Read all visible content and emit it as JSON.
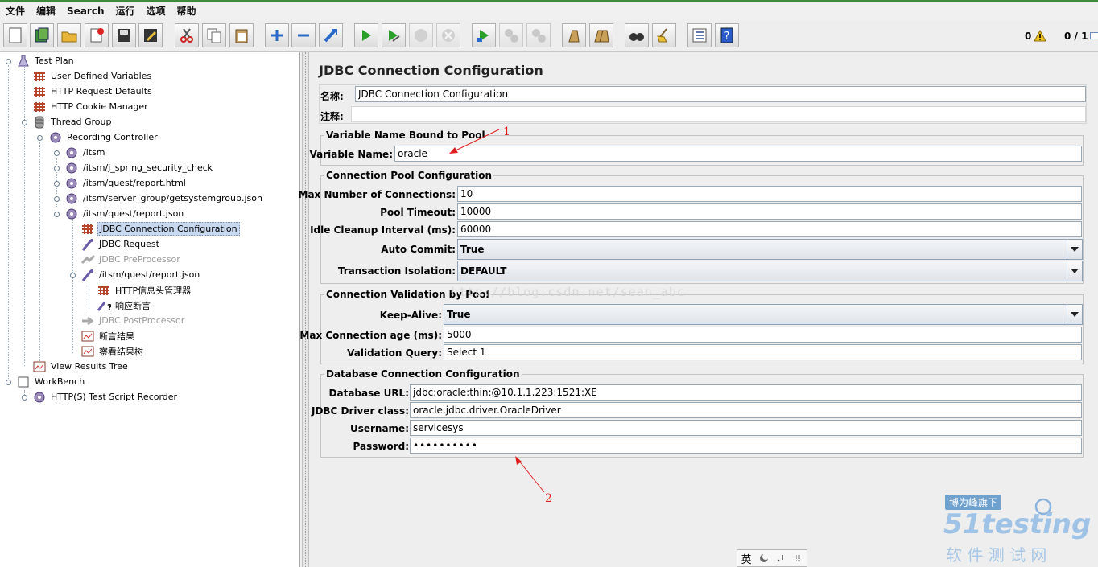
{
  "menu": [
    "文件",
    "编辑",
    "Search",
    "运行",
    "选项",
    "帮助"
  ],
  "toolbar": {
    "buttons": [
      "new-icon",
      "templates-icon",
      "open-icon",
      "close-file-icon",
      "save-icon",
      "save-as-icon",
      "cut-icon",
      "copy-icon",
      "paste-icon",
      "expand-icon",
      "collapse-icon",
      "toggle-icon",
      "start-icon",
      "start-no-pause-icon",
      "stop-icon",
      "shutdown-icon",
      "remote-start-icon",
      "remote-stop-icon",
      "remote-exit-icon",
      "clear-icon",
      "clear-all-icon",
      "search-icon",
      "reset-search-icon",
      "function-helper-icon",
      "help-icon"
    ],
    "error_count": "0",
    "threads": "0 / 1"
  },
  "tree": [
    {
      "label": "Test Plan",
      "icon": "test-plan-icon"
    },
    {
      "label": "User Defined Variables",
      "icon": "config-element-icon"
    },
    {
      "label": "HTTP Request Defaults",
      "icon": "config-element-icon"
    },
    {
      "label": "HTTP Cookie Manager",
      "icon": "config-element-icon"
    },
    {
      "label": "Thread Group",
      "icon": "thread-group-icon"
    },
    {
      "label": "Recording Controller",
      "icon": "controller-icon"
    },
    {
      "label": "/itsm",
      "icon": "controller-icon"
    },
    {
      "label": "/itsm/j_spring_security_check",
      "icon": "controller-icon"
    },
    {
      "label": "/itsm/quest/report.html",
      "icon": "controller-icon"
    },
    {
      "label": "/itsm/server_group/getsystemgroup.json",
      "icon": "controller-icon"
    },
    {
      "label": "/itsm/quest/report.json",
      "icon": "controller-icon"
    },
    {
      "label": "JDBC Connection Configuration",
      "icon": "config-element-icon",
      "selected": true
    },
    {
      "label": "JDBC Request",
      "icon": "sampler-icon"
    },
    {
      "label": "JDBC PreProcessor",
      "icon": "preprocessor-icon",
      "disabled": true
    },
    {
      "label": "/itsm/quest/report.json",
      "icon": "sampler-icon"
    },
    {
      "label": "HTTP信息头管理器",
      "icon": "config-element-icon"
    },
    {
      "label": "响应断言",
      "icon": "assertion-icon"
    },
    {
      "label": "JDBC PostProcessor",
      "icon": "postprocessor-icon",
      "disabled": true
    },
    {
      "label": "断言结果",
      "icon": "listener-icon"
    },
    {
      "label": "察看结果树",
      "icon": "listener-icon"
    },
    {
      "label": "View Results Tree",
      "icon": "listener-icon"
    },
    {
      "label": "WorkBench",
      "icon": "workbench-icon"
    },
    {
      "label": "HTTP(S) Test Script Recorder",
      "icon": "controller-icon"
    }
  ],
  "main": {
    "title": "JDBC Connection Configuration",
    "name_label": "名称:",
    "name_value": "JDBC Connection Configuration",
    "comment_label": "注释:",
    "comment_value": "",
    "pool_group": {
      "title": "Variable Name Bound to Pool",
      "var_label": "Variable Name:",
      "var_value": "oracle"
    },
    "conn_pool_group": {
      "title": "Connection Pool Configuration",
      "max_conn_label": "Max Number of Connections:",
      "max_conn_value": "10",
      "timeout_label": "Pool Timeout:",
      "timeout_value": "10000",
      "idle_label": "Idle Cleanup Interval (ms):",
      "idle_value": "60000",
      "autocommit_label": "Auto Commit:",
      "autocommit_value": "True",
      "isolation_label": "Transaction Isolation:",
      "isolation_value": "DEFAULT"
    },
    "validation_group": {
      "title": "Connection Validation by Pool",
      "keepalive_label": "Keep-Alive:",
      "keepalive_value": "True",
      "maxage_label": "Max Connection age (ms):",
      "maxage_value": "5000",
      "query_label": "Validation Query:",
      "query_value": "Select 1"
    },
    "db_group": {
      "title": "Database Connection Configuration",
      "url_label": "Database URL:",
      "url_value": "jdbc:oracle:thin:@10.1.1.223:1521:XE",
      "driver_label": "JDBC Driver class:",
      "driver_value": "oracle.jdbc.driver.OracleDriver",
      "user_label": "Username:",
      "user_value": "servicesys",
      "pass_label": "Password:",
      "pass_value": "••••••••••"
    }
  },
  "annotations": {
    "one": "1",
    "two": "2",
    "color": "#e02020"
  },
  "watermark": {
    "url": "http://blog.csdn.net/sean_abc",
    "badge": "博为峰旗下",
    "brand": "51testing",
    "tagline": "软 件 测 试 网"
  },
  "ime": {
    "lang": "英"
  }
}
